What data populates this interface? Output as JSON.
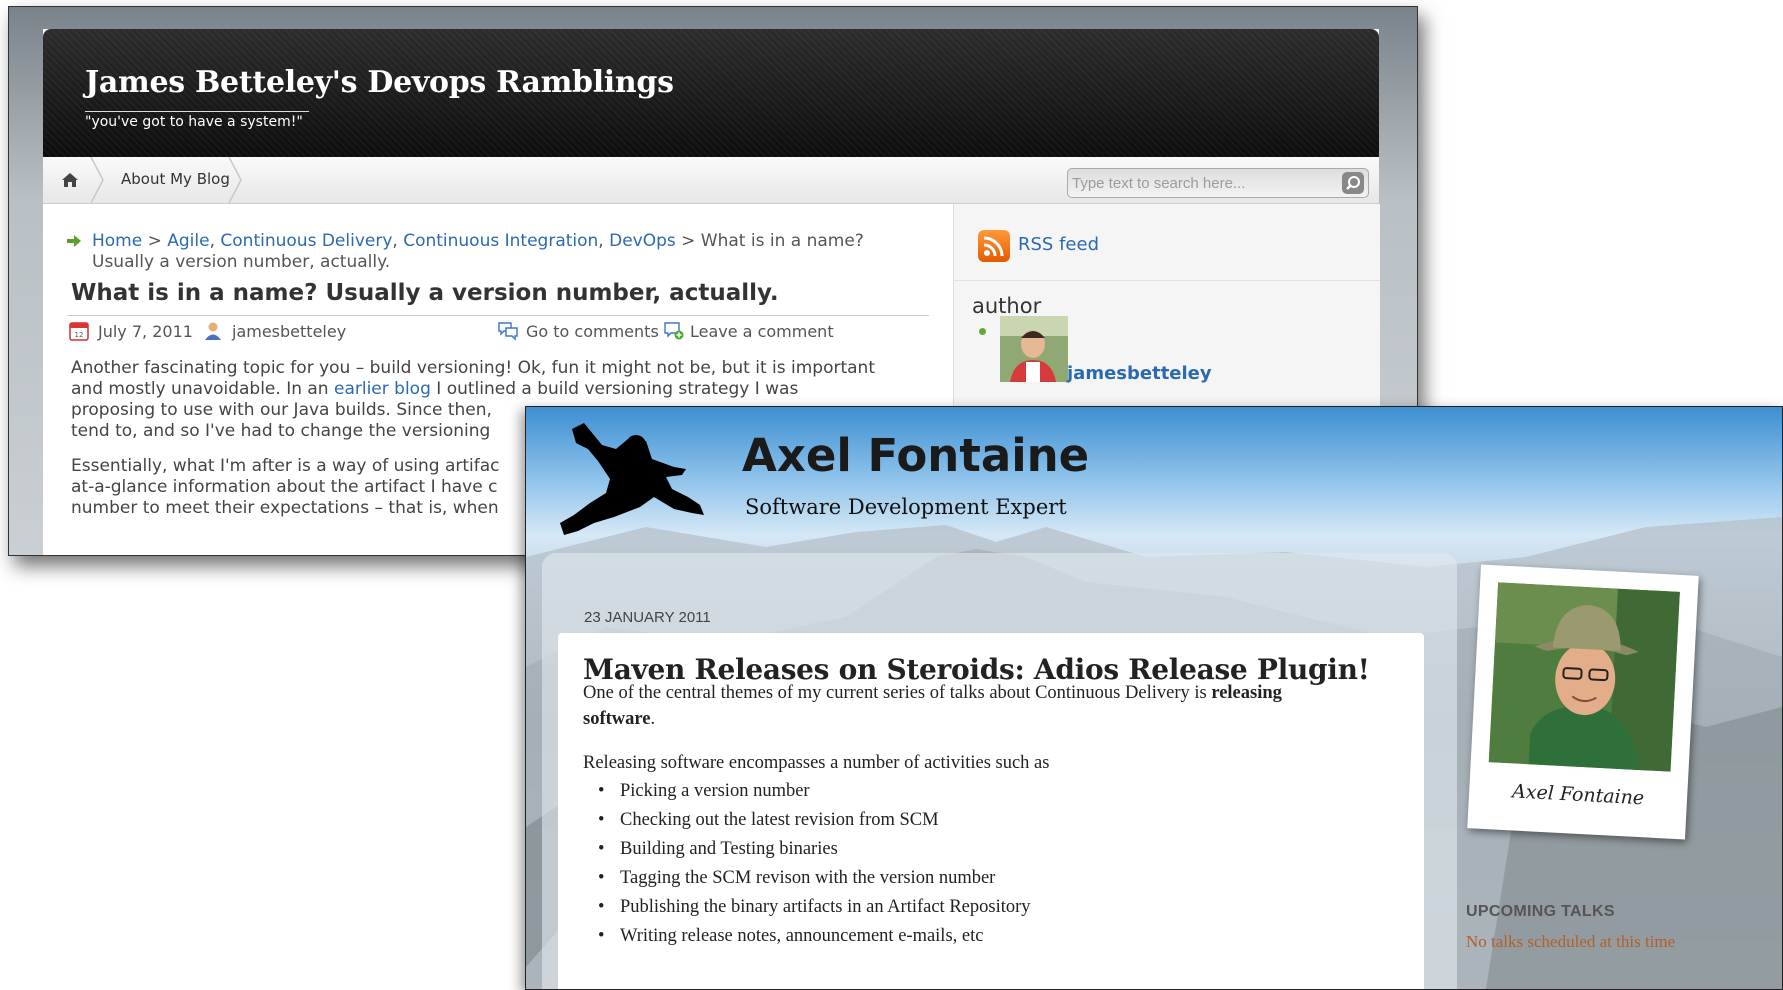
{
  "blog1": {
    "title": "James Betteley's Devops Ramblings",
    "tagline": "\"you've got to have a system!\"",
    "nav": {
      "about": "About My Blog"
    },
    "search": {
      "placeholder": "Type text to search here..."
    },
    "breadcrumb": {
      "home": "Home",
      "sep1": " > ",
      "cat1": "Agile",
      "cat2": "Continuous Delivery",
      "cat3": "Continuous Integration",
      "cat4": "DevOps",
      "current_part1": " > What is in a name?",
      "current_part2": "Usually a version number, actually.",
      "comma": ", "
    },
    "post": {
      "title": "What is in a name? Usually a version number, actually.",
      "date": "July 7, 2011",
      "author": "jamesbetteley",
      "go_to_comments": "Go to comments",
      "leave_comment": "Leave a comment",
      "p1_l1": "Another fascinating topic for you – build versioning! Ok, fun it might not be, but it is important",
      "p1_l2a": "and mostly unavoidable. In an ",
      "p1_l2_link": "earlier blog",
      "p1_l2b": " I outlined a build versioning strategy I was",
      "p1_l3": "proposing to use with our Java builds. Since then, ",
      "p1_l4": "tend to, and so I've had to change the versioning ",
      "p2_l1": "Essentially, what I'm after is a way of using artifac",
      "p2_l2": "at-a-glance information about the artifact I have c",
      "p2_l3": "number to meet their expectations – that is, when"
    },
    "sidebar": {
      "rss": "RSS feed",
      "author_heading": "author",
      "author_name": "jamesbetteley"
    }
  },
  "blog2": {
    "title": "Axel Fontaine",
    "tagline": "Software Development Expert",
    "post": {
      "date": "23 JANUARY 2011",
      "title": "Maven Releases on Steroids: Adios Release Plugin!",
      "p1_l1a": "One of the central themes of my current series of talks about Continuous Delivery is ",
      "p1_l1_bold": "releasing",
      "p1_l2_bold": "software",
      "p1_l2b": ".",
      "p2": "Releasing software encompasses a number of activities such as",
      "items": [
        "Picking a version number",
        "Checking out the latest revision from SCM",
        "Building and Testing binaries",
        "Tagging the SCM revison with the version number",
        "Publishing the binary artifacts in an Artifact Repository",
        "Writing release notes, announcement e-mails, etc"
      ]
    },
    "sidebar": {
      "polaroid_caption": "Axel Fontaine",
      "upcoming_heading": "UPCOMING TALKS",
      "upcoming_text": "No talks scheduled at this time"
    }
  },
  "icons": [
    "home-icon",
    "search-icon",
    "arrow-right-icon",
    "calendar-icon",
    "user-icon",
    "comments-icon",
    "add-comment-icon",
    "rss-icon",
    "bullet-icon",
    "ninja-logo-icon"
  ],
  "colors": {
    "link": "#2a6ab0",
    "header_dark": "#111111",
    "rss_orange": "#f08020",
    "talks_text": "#b45f2a"
  }
}
